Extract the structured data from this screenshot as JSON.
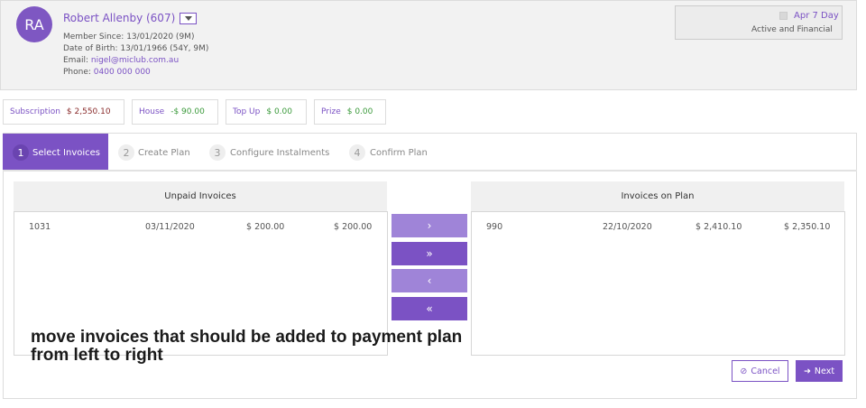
{
  "member": {
    "initials": "RA",
    "name": "Robert Allenby (607)",
    "member_since_label": "Member Since:",
    "member_since": "13/01/2020 (9M)",
    "dob_label": "Date of Birth:",
    "dob": "13/01/1966 (54Y, 9M)",
    "email_label": "Email:",
    "email": "nigel@miclub.com.au",
    "phone_label": "Phone:",
    "phone": "0400 000 000"
  },
  "status": {
    "date": "Apr 7 Day",
    "text": "Active and Financial"
  },
  "balances": [
    {
      "label": "Subscription",
      "value": "$ 2,550.10"
    },
    {
      "label": "House",
      "value": "-$ 90.00"
    },
    {
      "label": "Top Up",
      "value": "$ 0.00"
    },
    {
      "label": "Prize",
      "value": "$ 0.00"
    }
  ],
  "steps": [
    {
      "num": "1",
      "label": "Select Invoices",
      "active": true
    },
    {
      "num": "2",
      "label": "Create Plan",
      "active": false
    },
    {
      "num": "3",
      "label": "Configure Instalments",
      "active": false
    },
    {
      "num": "4",
      "label": "Confirm Plan",
      "active": false
    }
  ],
  "unpaid": {
    "title": "Unpaid Invoices",
    "rows": [
      {
        "number": "1031",
        "date": "03/11/2020",
        "amount": "$ 200.00",
        "outstanding": "$ 200.00"
      }
    ]
  },
  "on_plan": {
    "title": "Invoices on Plan",
    "rows": [
      {
        "number": "990",
        "date": "22/10/2020",
        "amount": "$ 2,410.10",
        "outstanding": "$ 2,350.10"
      }
    ]
  },
  "move_buttons": {
    "right": "›",
    "all_right": "»",
    "left": "‹",
    "all_left": "«"
  },
  "annotation": "move invoices that should be added to payment plan from left to right",
  "actions": {
    "cancel_icon": "⊘",
    "cancel": "Cancel",
    "next_icon": "➜",
    "next": "Next"
  },
  "colors": {
    "accent": "#7b52c4",
    "accent_light": "#9f84d8",
    "negative": "#8a2c2c",
    "positive": "#3b9a3b"
  },
  "icons": {
    "dropdown": "chevron-down-icon",
    "cancel": "ban-icon",
    "next": "arrow-right-icon"
  }
}
